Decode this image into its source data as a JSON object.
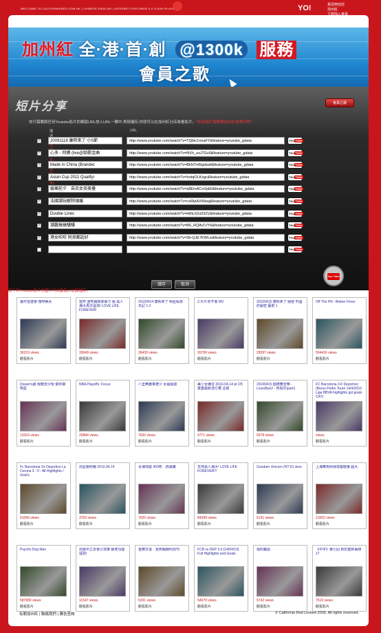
{
  "topbar": {
    "left": "WELCOME TO CALIFORNIARED.COM.HK   |   CHINESE ENGLISH   |   INTERNET EXPLORER 6.0 FLASH PLAYER 7",
    "yo": "YO!",
    "right_line1": "易迅西亞店",
    "right_line2": "加州紅",
    "right_line3": "立即加入會員",
    "brand_color": "#c9161c"
  },
  "banner": {
    "part1": "加州紅",
    "part2": "全",
    "part3": "港",
    "part4": "首",
    "part5": "創",
    "at": "@1300k",
    "svc": "服務",
    "line2": "會員之歌"
  },
  "share": {
    "title": "短片分享",
    "song_button": "會員之歌",
    "instruction": "你只需要將任何Youtube影片的網頁URL放入URL一欄中,再按儲存,你就可以在加州紅分店收看影片。",
    "instruction_red": "*所有短片需按照加州紅會員守則*",
    "header_desc": "描述",
    "header_desc_red": "(中文或英文,最多20個字)",
    "header_url": "URL",
    "rows": [
      {
        "checked": "✓",
        "desc": "20091118 康熙來了 小S節",
        "url": "http://www.youtube.com/watch?v=TQbtc1noaFY&feature=youtube_gdata"
      },
      {
        "checked": "✓",
        "desc": "心多 - 阿嬌 (live@勁歌金曲",
        "url": "http://www.youtube.com/watch?v=NVh_uxJ7Gv0&feature=youtube_gdata"
      },
      {
        "checked": "✓",
        "desc": "Made In China (Brandec",
        "url": "http://www.youtube.com/watch?v=BkNTxWgsba4&feature=youtube_gdata"
      },
      {
        "checked": "✓",
        "desc": "Asian Cup 2011 Qualifyi",
        "url": "http://www.youtube.com/watch?v=IrotqOLKzgc&feature=youtube_gdata"
      },
      {
        "checked": "✓",
        "desc": "娛樂前夕　自衣女孩美擾",
        "url": "http://www.youtube.com/watch?v=a8EmACoXpb0&feature=youtube_gdata"
      },
      {
        "checked": "✓",
        "desc": "法國潮玩解除頭痛",
        "url": "http://www.youtube.com/watch?v=coRlpAXWarg&feature=youtube_gdata"
      },
      {
        "checked": "✓",
        "desc": "Double Lines",
        "url": "http://www.youtube.com/watch?v=HthL62u03ZU&feature=youtube_gdata"
      },
      {
        "checked": "✓",
        "desc": "潮趣搞搞騷騷",
        "url": "http://www.youtube.com/watch?v=B6_RQ8v1VYk&feature=youtube_gdata"
      },
      {
        "checked": "✓",
        "desc": "港女吹吹 阿叔都話好",
        "url": "http://www.youtube.com/watch?v=3b-QJE7KWLw&feature=youtube_gdata"
      },
      {
        "checked": "",
        "desc": "",
        "url": ""
      }
    ],
    "yt_label": "You",
    "yt_tube": "Tube",
    "save": "儲存",
    "cancel": "取消"
  },
  "ytbadge": "You Tube",
  "section_heading": "按下列Youtube影片的圖片可自動貼上記錄儲存。",
  "videos": [
    {
      "title": "優可音譜會 咖啡美女",
      "views": "36319 views",
      "watch": "觀看影片"
    },
    {
      "title": "當杯 通宵病窩家暴力 阻 黑人潮大再次溫淘! LOVE LIFE FOREVER!",
      "views": "33649 views",
      "watch": "觀看影片"
    },
    {
      "title": "20100414 康熙來了 明星私房 日記 1-2",
      "views": "36439 views",
      "watch": "觀看影片"
    },
    {
      "title": "Z.H.H 你不會 MV",
      "views": "26799 views",
      "watch": "觀看影片"
    },
    {
      "title": "20100415 康熙來了 絕症 中國的秘密 藝術 1",
      "views": "29397 views",
      "watch": "觀看影片"
    },
    {
      "title": "Off The Pill - Bieber Fever",
      "views": "504416 views",
      "watch": "觀看影片"
    },
    {
      "title": "Dream's劇 我轉去沙咀 做你做明星",
      "views": "13319 views",
      "watch": "觀看影片"
    },
    {
      "title": "NBA Playoffs: Focus",
      "views": "20884 views",
      "watch": "觀看影片"
    },
    {
      "title": "八里無難車禮少 女最給搶",
      "views": "7630 views",
      "watch": "觀看影片"
    },
    {
      "title": "美少女練習 2010-04-14 pt 2/5 專業最新流行著 這樣",
      "views": "4771 views",
      "watch": "觀看影片"
    },
    {
      "title": "20100415 劉德華音樂 -Love(Bye2 - 何與仔)part1",
      "views": "5078 views",
      "watch": "觀看影片"
    },
    {
      "title": "FC Barcelona 3-0 Deportivo (Bresu Pedro Toure 14/4/2010 Liga BBVA highlights gol goals CAT)",
      "views": "views",
      "watch": "觀看影片"
    },
    {
      "title": "Fc Barcelona Vs Deportivo La Coruna 3 - 0 - All Highlights / Goal's",
      "views": "51065 views",
      "watch": "觀看影片"
    },
    {
      "title": "周星馳照親 2010.04.14",
      "views": "3753 views",
      "watch": "觀看影片"
    },
    {
      "title": "青海地震 400死　搞風藥",
      "views": "7620 views",
      "watch": "觀看影片"
    },
    {
      "title": "支持黑人潮大! LOVE LIFE FOREVER!!!",
      "views": "84399 views",
      "watch": "觀看影片"
    },
    {
      "title": "Gundam Unicorn (NT-D) view",
      "views": "6131 views",
      "watch": "觀看影片"
    },
    {
      "title": "上海華為明珠塔客觀第 超大",
      "views": "21002 views",
      "watch": "觀看影片"
    },
    {
      "title": "Psycho Dog Man",
      "views": "587680 views",
      "watch": "觀看影片"
    },
    {
      "title": "周遊中立去會公眾席 願老功能提扣!",
      "views": "11547 views",
      "watch": "觀看影片"
    },
    {
      "title": "重療文協　受到報酬利完刊",
      "views": "5331 views",
      "watch": "觀看影片"
    },
    {
      "title": "FCB vs DEP 3-0 [14/04/10] Full Highlights and Goals",
      "views": "54979 views",
      "watch": "觀看影片"
    },
    {
      "title": "我的獨語",
      "views": "5742 views",
      "watch": "觀看影片"
    },
    {
      "title": "【中字】第七回 對抗重新萬隊 17",
      "views": "7519 views",
      "watch": "觀看影片"
    }
  ],
  "footer": {
    "links": "有關加州紅 | 聯絡我們 | 廣告查詢",
    "copyright": "© California Red Limited 2009. All rights reserved."
  }
}
